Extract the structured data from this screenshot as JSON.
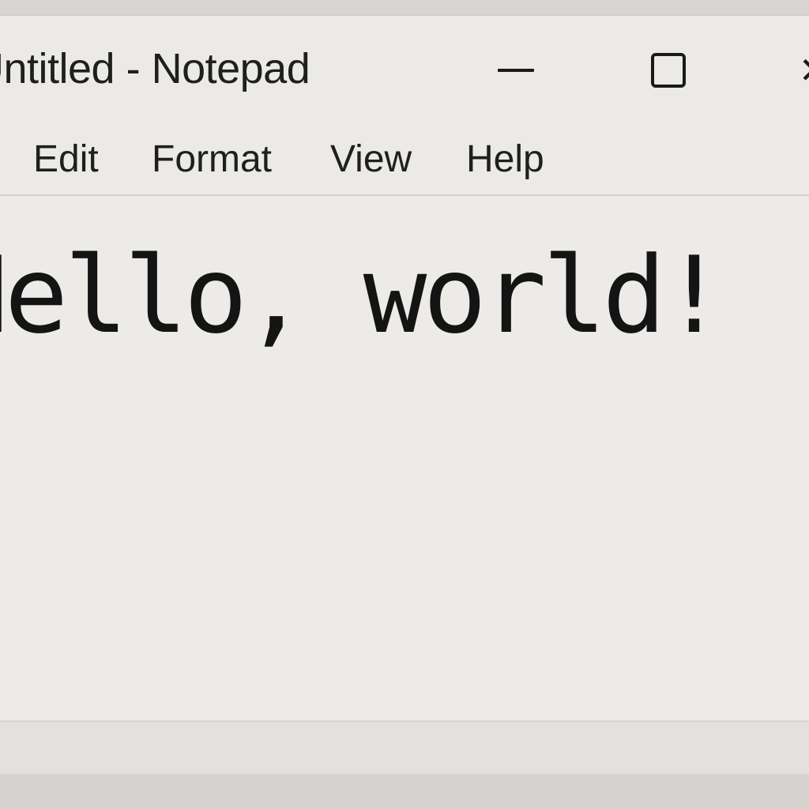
{
  "window": {
    "title": "Untitled - Notepad"
  },
  "title_controls": {
    "minimize_icon": "minimize-icon",
    "maximize_icon": "maximize-icon",
    "close_icon": "close-icon"
  },
  "menu": {
    "items": [
      {
        "label": "Edit"
      },
      {
        "label": "Format"
      },
      {
        "label": "View"
      },
      {
        "label": "Help"
      }
    ]
  },
  "editor": {
    "content": "Hello, world!"
  }
}
